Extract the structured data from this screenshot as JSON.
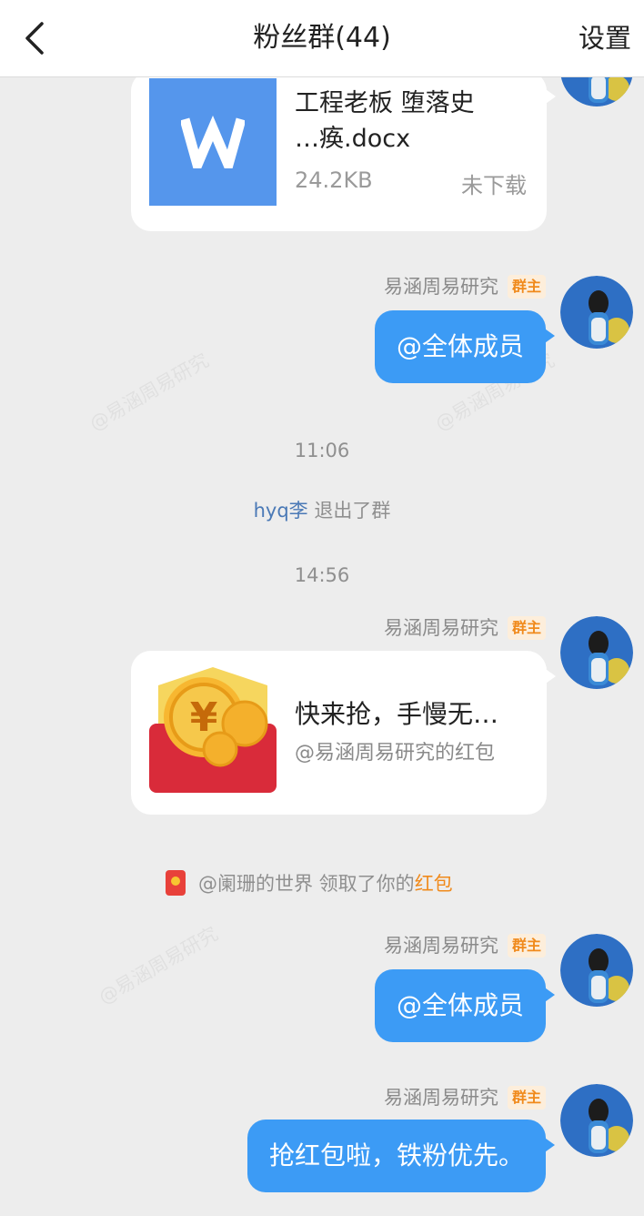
{
  "header": {
    "title": "粉丝群(44)",
    "settings_label": "设置"
  },
  "messages": {
    "file": {
      "name": "工程老板 堕落史 …痪.docx",
      "size": "24.2KB",
      "status": "未下载",
      "icon_letter": "W"
    },
    "msg1": {
      "sender": "易涵周易研究",
      "badge": "群主",
      "text": "@全体成员"
    },
    "time1": "11:06",
    "leave": {
      "user": "hyq李",
      "text": " 退出了群"
    },
    "time2": "14:56",
    "msg2": {
      "sender": "易涵周易研究",
      "badge": "群主",
      "rp_title": "快来抢，手慢无…",
      "rp_sub": "@易涵周易研究的红包"
    },
    "claim": {
      "text": "@阑珊的世界 领取了你的",
      "link": "红包"
    },
    "msg3": {
      "sender": "易涵周易研究",
      "badge": "群主",
      "text": "@全体成员"
    },
    "msg4": {
      "sender": "易涵周易研究",
      "badge": "群主",
      "text": "抢红包啦，铁粉优先。"
    }
  },
  "icons": [
    "back-arrow-icon",
    "word-doc-icon",
    "red-packet-icon",
    "avatar"
  ],
  "colors": {
    "bubble": "#3c9bf5",
    "badge": "#f08a1c",
    "link": "#4a79b6",
    "background": "#ededed",
    "doc_icon": "#5596ec"
  }
}
